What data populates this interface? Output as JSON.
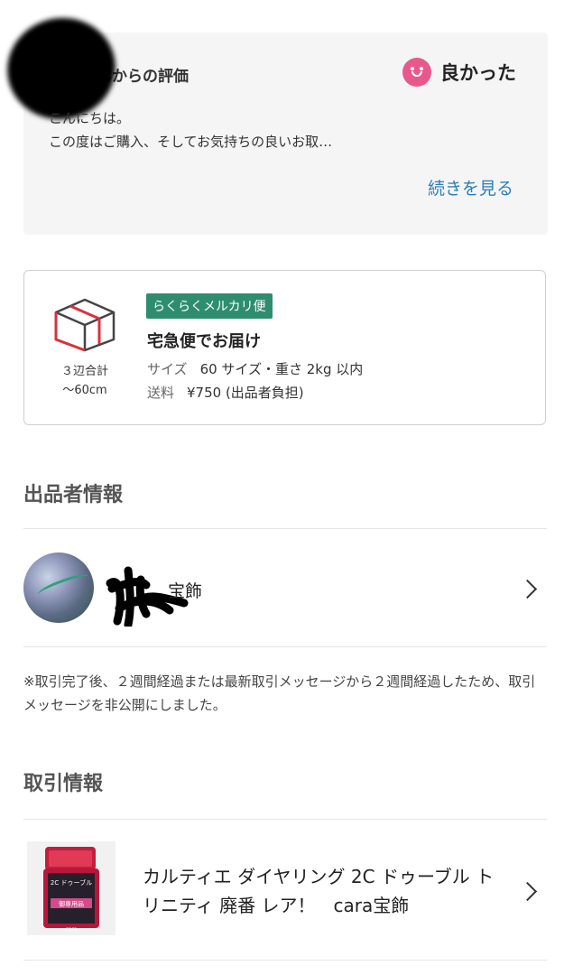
{
  "review": {
    "title": "宝飾さんからの評価",
    "rating_label": "良かった",
    "body_line1": "こんにちは。",
    "body_line2": "この度はご購入、そしてお気持ちの良いお取…",
    "read_more": "続きを見る"
  },
  "shipping": {
    "badge": "らくらくメルカリ便",
    "method": "宅急便でお届け",
    "size_caption_line1": "３辺合計",
    "size_caption_line2": "～60cm",
    "size_label": "サイズ",
    "size_value": "60 サイズ・重さ 2kg 以内",
    "fee_label": "送料",
    "fee_value": "¥750 (出品者負担)"
  },
  "seller_section": {
    "title": "出品者情報",
    "seller_name": "宝飾",
    "notice": "※取引完了後、２週間経過または最新取引メッセージから２週間経過したため、取引メッセージを非公開にしました。"
  },
  "transaction": {
    "title": "取引情報",
    "product_title": "カルティエ ダイヤリング 2C ドゥーブル トリニティ 廃番 レア！　cara宝飾",
    "thumb_text": "2C ドゥーブル",
    "thumb_tag": "御専用品",
    "thumb_brand": "cara"
  },
  "colors": {
    "accent_pink": "#e8598b",
    "link_blue": "#2b7fb8",
    "badge_green": "#2e8d6e",
    "box_red": "#d9323e"
  }
}
